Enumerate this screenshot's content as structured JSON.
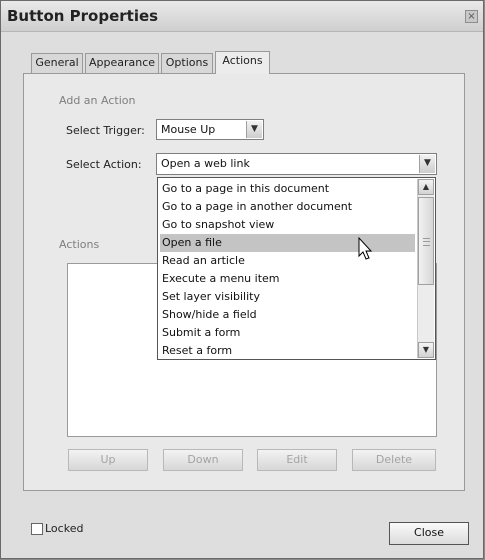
{
  "window": {
    "title": "Button Properties",
    "close_glyph": "×"
  },
  "tabs": [
    {
      "label": "General",
      "active": false
    },
    {
      "label": "Appearance",
      "active": false
    },
    {
      "label": "Options",
      "active": false
    },
    {
      "label": "Actions",
      "active": true
    }
  ],
  "add_action": {
    "group_title": "Add an Action",
    "trigger_label": "Select Trigger:",
    "trigger_value": "Mouse Up",
    "action_label": "Select Action:",
    "action_value": "Open a web link"
  },
  "action_options": [
    "Go to a page in this document",
    "Go to a page in another document",
    "Go to snapshot view",
    "Open a file",
    "Read an article",
    "Execute a menu item",
    "Set layer visibility",
    "Show/hide a field",
    "Submit a form",
    "Reset a form"
  ],
  "highlighted_option": "Open a file",
  "actions_group_title": "Actions",
  "buttons": {
    "up": "Up",
    "down": "Down",
    "edit": "Edit",
    "delete": "Delete"
  },
  "locked_label": "Locked",
  "locked_checked": false,
  "close_button": "Close",
  "icons": {
    "dropdown": "chevron-down-icon",
    "scroll_up": "arrow-up-icon",
    "scroll_down": "arrow-down-icon",
    "cursor": "mouse-pointer-icon"
  }
}
